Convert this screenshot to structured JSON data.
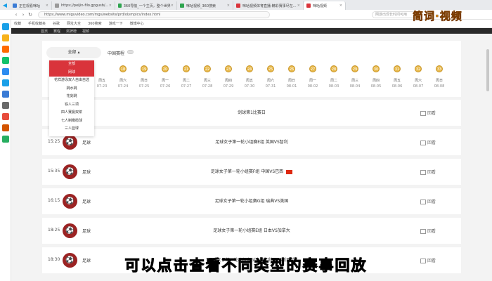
{
  "browser": {
    "tabs": [
      {
        "label": "正在观看咪咕",
        "color": "#3a7bd5",
        "active": false
      },
      {
        "label": "https://peijin-filo.gpgusb/...",
        "color": "#999999",
        "active": false
      },
      {
        "label": "360导航_一个主页，整个世界",
        "color": "#2ea44f",
        "active": false
      },
      {
        "label": "咪咕视频_360搜索",
        "color": "#2ea44f",
        "active": false
      },
      {
        "label": "咪咕视频体育直播-精彩赛事尽在...",
        "color": "#d9343b",
        "active": false
      },
      {
        "label": "咪咕视频",
        "color": "#d9343b",
        "active": true
      }
    ],
    "url": "https://www.miguvideo.com/mgs/website/prd/olympics/index.html",
    "search_placeholder": "网游出现长时间可用",
    "bookmarks": [
      "收藏",
      "手机收藏夹",
      "谷歌",
      "网址大全",
      "360搜索",
      "游戏一下",
      "微博中心"
    ],
    "nav_sections": [
      "首页",
      "赛程",
      "奖牌榜",
      "视频"
    ]
  },
  "branding": "简词·视频",
  "filter": {
    "selected": "全部",
    "live_label": "中国赛程",
    "options": [
      "全部",
      "网球",
      "花样游泳双人自由自选",
      "跳水跳",
      "花剑跳",
      "铁人三项",
      "四人赛艇双桨",
      "七人制橄榄球",
      "三人篮球"
    ],
    "selected_index": 1
  },
  "dates": [
    {
      "badge": "",
      "wk": "周五",
      "d": "07-23"
    },
    {
      "badge": "18",
      "wk": "周六",
      "d": "07-24"
    },
    {
      "badge": "19",
      "wk": "周日",
      "d": "07-25"
    },
    {
      "badge": "20",
      "wk": "周一",
      "d": "07-26"
    },
    {
      "badge": "21",
      "wk": "周二",
      "d": "07-27"
    },
    {
      "badge": "22",
      "wk": "周三",
      "d": "07-28"
    },
    {
      "badge": "23",
      "wk": "周四",
      "d": "07-29"
    },
    {
      "badge": "24",
      "wk": "周五",
      "d": "07-30"
    },
    {
      "badge": "25",
      "wk": "周六",
      "d": "07-31"
    },
    {
      "badge": "26",
      "wk": "周日",
      "d": "08-01"
    },
    {
      "badge": "27",
      "wk": "周一",
      "d": "08-02"
    },
    {
      "badge": "28",
      "wk": "周二",
      "d": "08-03"
    },
    {
      "badge": "29",
      "wk": "周三",
      "d": "08-04"
    },
    {
      "badge": "30",
      "wk": "周四",
      "d": "08-05"
    },
    {
      "badge": "31",
      "wk": "周五",
      "d": "08-06"
    },
    {
      "badge": "32",
      "wk": "周六",
      "d": "08-07"
    },
    {
      "badge": "33",
      "wk": "周日",
      "d": "08-08"
    }
  ],
  "events": [
    {
      "time": "",
      "sport": "",
      "title": "剑球第1比赛日",
      "replay": "回看",
      "icon": false
    },
    {
      "time": "15:25",
      "sport": "足球",
      "title": "足球女子第一轮小组赛E组 英国VS智利",
      "replay": "回看",
      "icon": true
    },
    {
      "time": "15:35",
      "sport": "足球",
      "title": "足球女子第一轮小组赛F组 中国VS巴西",
      "replay": "回看",
      "icon": true,
      "flag": true
    },
    {
      "time": "16:15",
      "sport": "足球",
      "title": "足球女子第一轮小组赛G组 瑞典VS美国",
      "replay": "回看",
      "icon": true
    },
    {
      "time": "18:25",
      "sport": "足球",
      "title": "足球女子第一轮小组赛E组 日本VS加拿大",
      "replay": "回看",
      "icon": true
    },
    {
      "time": "18:30",
      "sport": "足球",
      "title": "足球女子第一轮小组赛G组 澳大利亚VS新西兰",
      "replay": "回看",
      "icon": true
    }
  ],
  "caption": "可以点击查看不同类型的赛事回放"
}
